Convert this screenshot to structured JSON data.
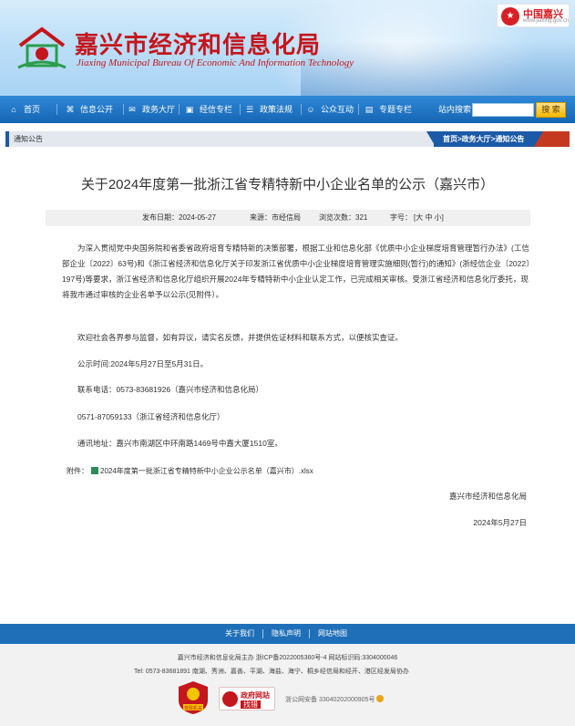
{
  "header": {
    "title": "嘉兴市经济和信息化局",
    "subtitle": "Jiaxing Municipal Bureau Of Economic And Information Technology",
    "badge_name": "中国嘉兴",
    "badge_url": "www.jiaxing.gov.cn",
    "colors": {
      "title": "#c4161c",
      "nav": "#1566b4"
    }
  },
  "nav": {
    "items": [
      {
        "label": "首页",
        "icon": "home-icon"
      },
      {
        "label": "信息公开",
        "icon": "sitemap-icon"
      },
      {
        "label": "政务大厅",
        "icon": "chat-icon"
      },
      {
        "label": "经信专栏",
        "icon": "briefcase-icon"
      },
      {
        "label": "政策法规",
        "icon": "list-icon"
      },
      {
        "label": "公众互动",
        "icon": "people-icon"
      },
      {
        "label": "专题专栏",
        "icon": "document-icon"
      }
    ],
    "search_label": "站内搜索",
    "search_placeholder": "",
    "search_button": "搜 索"
  },
  "breadcrumb": {
    "section": "通知公告",
    "path": "首页>政务大厅>通知公告"
  },
  "article": {
    "title": "关于2024年度第一批浙江省专精特新中小企业名单的公示（嘉兴市）",
    "meta": {
      "date": "发布日期：2024-05-27",
      "source": "来源：市经信局",
      "views": "浏览次数：321",
      "font_label": "字号：",
      "font_sizes": "[大 中 小]"
    },
    "paragraph1": "为深入贯彻党中央国务院和省委省政府培育专精特新的决策部署，根据工业和信息化部《优质中小企业梯度培育管理暂行办法》(工信部企业〔2022〕63号)和《浙江省经济和信息化厅关于印发浙江省优质中小企业梯度培育管理实施细则(暂行)的通知》(浙经信企业〔2022〕197号)等要求，浙江省经济和信息化厅组织开展2024年专精特新中小企业认定工作，已完成相关审核。受浙江省经济和信息化厅委托，现将我市通过审核的企业名单予以公示(见附件）。",
    "paragraph2": "欢迎社会各界参与监督，如有异议，请实名反馈，并提供佐证材料和联系方式，以便核实查证。",
    "period": "公示时间:2024年5月27日至5月31日。",
    "phone1": "联系电话：0573-83681926（嘉兴市经济和信息化局）",
    "phone2": "0571-87059133（浙江省经济和信息化厅）",
    "address": "通讯地址：嘉兴市南湖区中环南路1469号中嘉大厦1510室。",
    "attachment_label": "附件：",
    "attachment_file": "2024年度第一批浙江省专精特新中小企业公示名单（嘉兴市）.xlsx",
    "signature": "嘉兴市经济和信息化局",
    "sign_date": "2024年5月27日"
  },
  "footer": {
    "links": [
      "关于我们",
      "隐私声明",
      "网站地图"
    ],
    "line1": "嘉兴市经济和信息化局主办 浙ICP备2022005360号-4 网站标识码:3304000046",
    "line2": "Tel:  0573-83681891 南湖、秀洲、嘉善、平湖、海盐、海宁、桐乡经信局和经开、港区经发局协办",
    "party_badge": "党政机关",
    "gov_badge_line1": "政府网站",
    "gov_badge_line2": "找错",
    "police": "浙公网安备 33040202000905号"
  }
}
